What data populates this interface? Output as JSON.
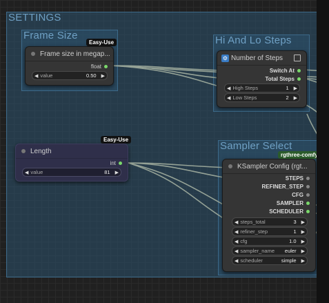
{
  "groups": {
    "settings": "SETTINGS",
    "frame_size": "Frame Size",
    "hi_lo_steps": "Hi And Lo Steps",
    "sampler_select": "Sampler Select"
  },
  "frame_size_node": {
    "badge": "Easy-Use",
    "title": "Frame size in megap...",
    "output": "float",
    "widget": {
      "label": "value",
      "value": "0.50"
    }
  },
  "steps_node": {
    "title": "Number of Steps",
    "outputs": [
      "Switch At",
      "Total Steps"
    ],
    "widgets": [
      {
        "label": "High Steps",
        "value": "1"
      },
      {
        "label": "Low Steps",
        "value": "2"
      }
    ]
  },
  "length_node": {
    "badge": "Easy-Use",
    "title": "Length",
    "output": "int",
    "widget": {
      "label": "value",
      "value": "81"
    }
  },
  "ksampler_node": {
    "badge": "rgthree-comfy",
    "title": "KSampler Config (rgt...",
    "outputs": [
      "STEPS",
      "REFINER_STEP",
      "CFG",
      "SAMPLER",
      "SCHEDULER"
    ],
    "widgets": [
      {
        "label": "steps_total",
        "value": "3"
      },
      {
        "label": "refiner_step",
        "value": "1"
      },
      {
        "label": "cfg",
        "value": "1.0"
      },
      {
        "label": "sampler_name",
        "value": "euler"
      },
      {
        "label": "scheduler",
        "value": "simple"
      }
    ]
  },
  "colors": {
    "group_border": "#3d6a8a",
    "group_fill": "#2c526e",
    "group_title": "#6fa0c4",
    "node_bg": "#353535",
    "length_node_bg": "#2f2f4a",
    "slot_connected": "#7ad86b",
    "slot_unconnected": "#888888",
    "wire": "#a9b5a4"
  }
}
